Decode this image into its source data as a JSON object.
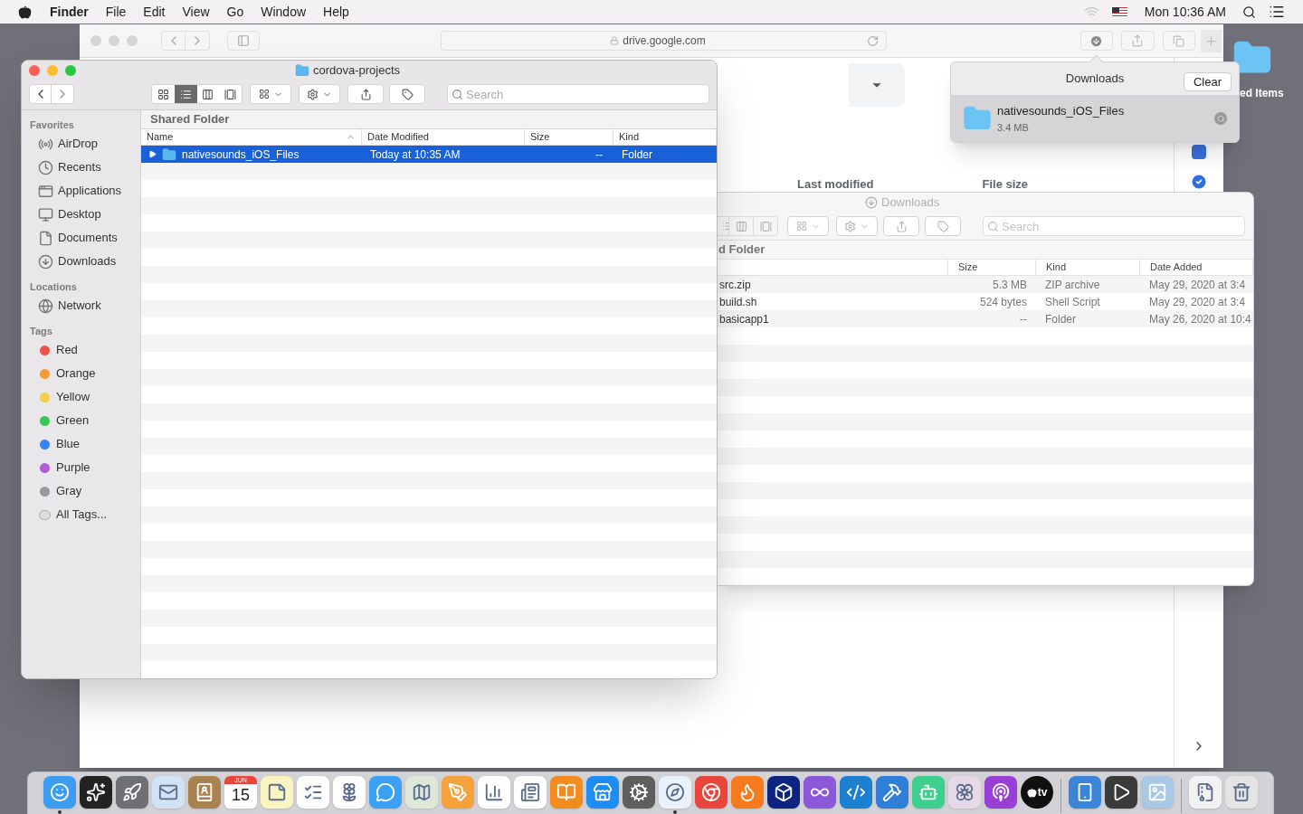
{
  "menu_bar": {
    "app": "Finder",
    "menus": [
      "File",
      "Edit",
      "View",
      "Go",
      "Window",
      "Help"
    ],
    "clock": "Mon 10:36 AM"
  },
  "safari": {
    "url": "drive.google.com",
    "columns": [
      "Last modified",
      "File size"
    ]
  },
  "downloads_popover": {
    "title": "Downloads",
    "clear": "Clear",
    "item": {
      "name": "nativesounds_iOS_Files",
      "size": "3.4 MB"
    }
  },
  "desktop_icon": {
    "label": "ed Items"
  },
  "back_finder": {
    "title": "Downloads",
    "search": {
      "placeholder": "Search"
    },
    "path": "d Folder",
    "columns": [
      "Size",
      "Kind",
      "Date Added"
    ],
    "rows": [
      {
        "name": "src.zip",
        "size": "5.3 MB",
        "kind": "ZIP archive",
        "date_added": "May 29, 2020 at 3:4"
      },
      {
        "name": "build.sh",
        "size": "524 bytes",
        "kind": "Shell Script",
        "date_added": "May 29, 2020 at 3:4"
      },
      {
        "name": "basicapp1",
        "size": "--",
        "kind": "Folder",
        "date_added": "May 26, 2020 at 10:4"
      }
    ]
  },
  "finder": {
    "title": "cordova-projects",
    "view_modes": [
      {
        "kind": "icon",
        "selected": false
      },
      {
        "kind": "list",
        "selected": true
      },
      {
        "kind": "column",
        "selected": false
      },
      {
        "kind": "gallery",
        "selected": false
      }
    ],
    "search": {
      "placeholder": "Search"
    },
    "sidebar": [
      {
        "heading": "Favorites",
        "items": [
          {
            "kind": "airdrop",
            "label": "AirDrop"
          },
          {
            "kind": "recents",
            "label": "Recents"
          },
          {
            "kind": "applications",
            "label": "Applications"
          },
          {
            "kind": "desktop",
            "label": "Desktop"
          },
          {
            "kind": "documents",
            "label": "Documents"
          },
          {
            "kind": "downloads",
            "label": "Downloads"
          }
        ]
      },
      {
        "heading": "Locations",
        "items": [
          {
            "kind": "network",
            "label": "Network"
          }
        ]
      },
      {
        "heading": "Tags",
        "items": [
          {
            "kind": "tag",
            "label": "Red",
            "color": "#f2504b"
          },
          {
            "kind": "tag",
            "label": "Orange",
            "color": "#f59a38"
          },
          {
            "kind": "tag",
            "label": "Yellow",
            "color": "#f7cd46"
          },
          {
            "kind": "tag",
            "label": "Green",
            "color": "#36c759"
          },
          {
            "kind": "tag",
            "label": "Blue",
            "color": "#3a82f7"
          },
          {
            "kind": "tag",
            "label": "Purple",
            "color": "#af5cd6"
          },
          {
            "kind": "tag",
            "label": "Gray",
            "color": "#98989d"
          },
          {
            "kind": "all",
            "label": "All Tags..."
          }
        ]
      }
    ],
    "path": "Shared Folder",
    "columns": [
      "Name",
      "Date Modified",
      "Size",
      "Kind"
    ],
    "rows": [
      {
        "name": "nativesounds_iOS_Files",
        "date_modified": "Today at 10:35 AM",
        "size": "--",
        "kind": "Folder",
        "selected": true,
        "expanded": false
      }
    ]
  },
  "dock": {
    "items": [
      {
        "kind": "finder",
        "running": true
      },
      {
        "kind": "siri",
        "running": false
      },
      {
        "kind": "launchpad",
        "running": false
      },
      {
        "kind": "mail",
        "running": false
      },
      {
        "kind": "contacts",
        "running": false
      },
      {
        "kind": "calendar",
        "running": false,
        "month": "JUN",
        "day": "15"
      },
      {
        "kind": "notes",
        "running": false
      },
      {
        "kind": "reminders",
        "running": false
      },
      {
        "kind": "photos",
        "running": false
      },
      {
        "kind": "messages",
        "running": false
      },
      {
        "kind": "maps",
        "running": false
      },
      {
        "kind": "pages",
        "running": false
      },
      {
        "kind": "numbers",
        "running": false
      },
      {
        "kind": "news",
        "running": false
      },
      {
        "kind": "books",
        "running": false
      },
      {
        "kind": "appstore",
        "running": false
      },
      {
        "kind": "prefs",
        "running": false
      },
      {
        "kind": "safari",
        "running": true
      },
      {
        "kind": "chrome",
        "running": false
      },
      {
        "kind": "firefox",
        "running": false
      },
      {
        "kind": "dropbox",
        "running": false
      },
      {
        "kind": "vs",
        "running": false
      },
      {
        "kind": "vscode",
        "running": false
      },
      {
        "kind": "xcode",
        "running": false
      },
      {
        "kind": "androidstudio",
        "running": false
      },
      {
        "kind": "flower",
        "running": false
      },
      {
        "kind": "podcasts",
        "running": false
      },
      {
        "kind": "tv",
        "running": false,
        "label": "tv"
      },
      {
        "kind": "separator"
      },
      {
        "kind": "simulator",
        "running": false
      },
      {
        "kind": "sublime",
        "running": false
      },
      {
        "kind": "preview",
        "running": false
      },
      {
        "kind": "separator"
      },
      {
        "kind": "zip",
        "running": false
      },
      {
        "kind": "trash",
        "running": false
      }
    ]
  }
}
